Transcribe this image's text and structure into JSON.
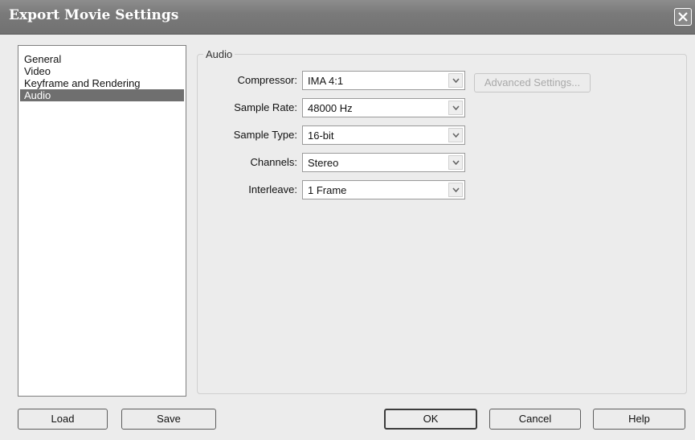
{
  "window": {
    "title": "Export Movie Settings"
  },
  "sidebar": {
    "items": [
      "General",
      "Video",
      "Keyframe and Rendering",
      "Audio"
    ],
    "selected": "Audio"
  },
  "audio": {
    "group_label": "Audio",
    "compressor": {
      "label": "Compressor:",
      "value": "IMA 4:1"
    },
    "sample_rate": {
      "label": "Sample Rate:",
      "value": "48000 Hz"
    },
    "sample_type": {
      "label": "Sample Type:",
      "value": "16-bit"
    },
    "channels": {
      "label": "Channels:",
      "value": "Stereo"
    },
    "interleave": {
      "label": "Interleave:",
      "value": "1 Frame"
    },
    "advanced_button": "Advanced Settings..."
  },
  "footer": {
    "load": "Load",
    "save": "Save",
    "ok": "OK",
    "cancel": "Cancel",
    "help": "Help"
  }
}
